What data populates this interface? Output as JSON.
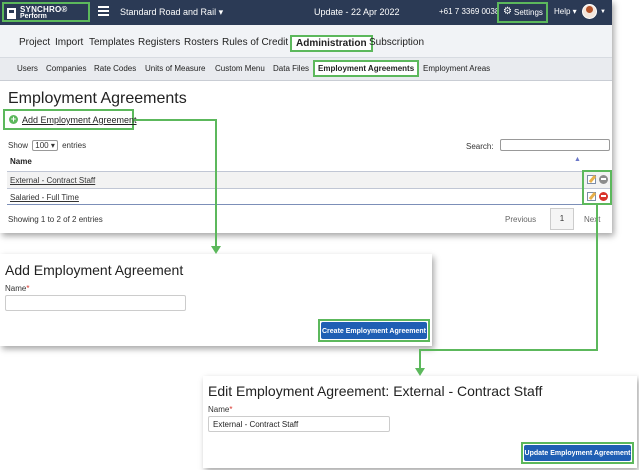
{
  "header": {
    "logo_title": "SYNCHRO®",
    "logo_sub": "Perform",
    "project": "Standard Road and Rail ▾",
    "update": "Update - 22 Apr 2022",
    "phone": "+61 7 3369 0038",
    "settings": "Settings",
    "help": "Help ▾"
  },
  "nav_main": [
    "Project",
    "Import",
    "Templates",
    "Registers",
    "Rosters",
    "Rules of Credit",
    "Administration",
    "Subscription"
  ],
  "nav_sub": [
    "Users",
    "Companies",
    "Rate Codes",
    "Units of Measure",
    "Custom Menu",
    "Data Files",
    "Employment Agreements",
    "Employment Areas"
  ],
  "page": {
    "title": "Employment Agreements",
    "add_link": "Add Employment Agreement",
    "show_prefix": "Show",
    "show_value": "100 ▾",
    "show_suffix": "entries",
    "search_label": "Search:",
    "column_name": "Name",
    "sort_icon": "▲",
    "rows": [
      "External - Contract Staff",
      "Salaried - Full Time"
    ],
    "showing": "Showing 1 to 2 of 2 entries",
    "prev": "Previous",
    "page_num": "1",
    "next": "Next"
  },
  "add_dialog": {
    "title": "Add Employment Agreement",
    "name_label": "Name",
    "required": "*",
    "name_value": "",
    "button": "Create Employment Agreement"
  },
  "edit_dialog": {
    "title": "Edit Employment Agreement: External - Contract Staff",
    "name_label": "Name",
    "required": "*",
    "name_value": "External - Contract Staff",
    "button": "Update Employment Agreement"
  },
  "colors": {
    "highlight": "#5cb85c",
    "topbar": "#2b3a55",
    "primary_button": "#1f5fb4",
    "required": "#d9342b"
  }
}
